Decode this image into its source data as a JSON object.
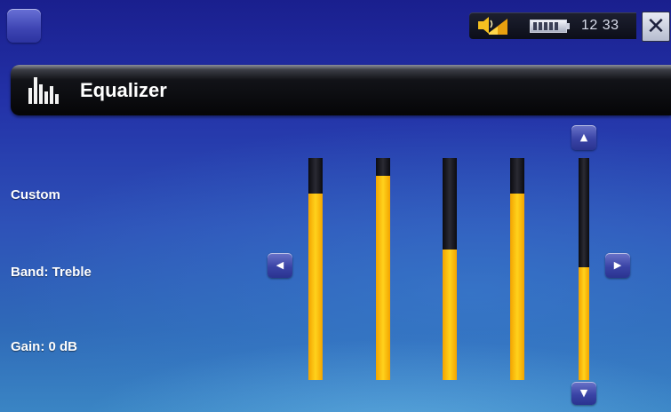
{
  "status_bar": {
    "time": "12 33",
    "volume_icon": "volume-speaker-icon",
    "battery_icon": "battery-icon",
    "close_label": "✕"
  },
  "title_bar": {
    "title": "Equalizer",
    "icon": "equalizer-icon"
  },
  "settings": {
    "preset": "Custom",
    "band": "Band: Treble",
    "gain": "Gain: 0 dB"
  },
  "controls": {
    "left_arrow": "◀",
    "right_arrow": "▶",
    "up_arrow": "▲",
    "down_arrow": "▼"
  },
  "bands": [
    {
      "level": 0.84,
      "selected": false
    },
    {
      "level": 0.92,
      "selected": false
    },
    {
      "level": 0.59,
      "selected": false
    },
    {
      "level": 0.84,
      "selected": false
    },
    {
      "level": 0.51,
      "selected": true
    }
  ],
  "colors": {
    "slider_fill": "#ffc20e",
    "slider_track": "#15151c",
    "background_top": "#1a1f8e",
    "background_bottom": "#3a85c4"
  }
}
